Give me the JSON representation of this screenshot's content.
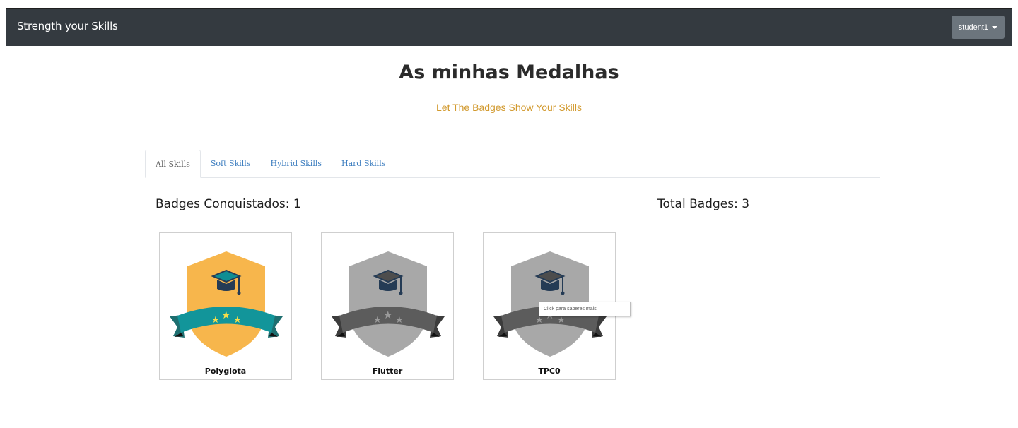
{
  "navbar": {
    "brand": "Strength your Skills",
    "user": "student1"
  },
  "page": {
    "title": "As minhas Medalhas",
    "subtitle": "Let The Badges Show Your Skills"
  },
  "tabs": [
    {
      "label": "All Skills",
      "active": true
    },
    {
      "label": "Soft Skills",
      "active": false
    },
    {
      "label": "Hybrid Skills",
      "active": false
    },
    {
      "label": "Hard Skills",
      "active": false
    }
  ],
  "stats": {
    "conquered": "Badges Conquistados: 1",
    "total": "Total Badges: 3"
  },
  "badges": [
    {
      "name": "Polyglota",
      "earned": true,
      "icon": "graduation-cap-shield-badge"
    },
    {
      "name": "Flutter",
      "earned": false,
      "icon": "graduation-cap-shield-badge"
    },
    {
      "name": "TPC0",
      "earned": false,
      "icon": "graduation-cap-shield-badge"
    }
  ],
  "tooltip": "Click para saberes mais",
  "colors": {
    "navbar": "#343a40",
    "user_button": "#6c757d",
    "subtitle": "#d29a2f",
    "tab_link": "#3f7fc0",
    "earned_shield": "#f7b64c",
    "earned_ribbon": "#12959a",
    "locked_shield": "#a8a8a8",
    "locked_ribbon": "#5c5c5c"
  }
}
